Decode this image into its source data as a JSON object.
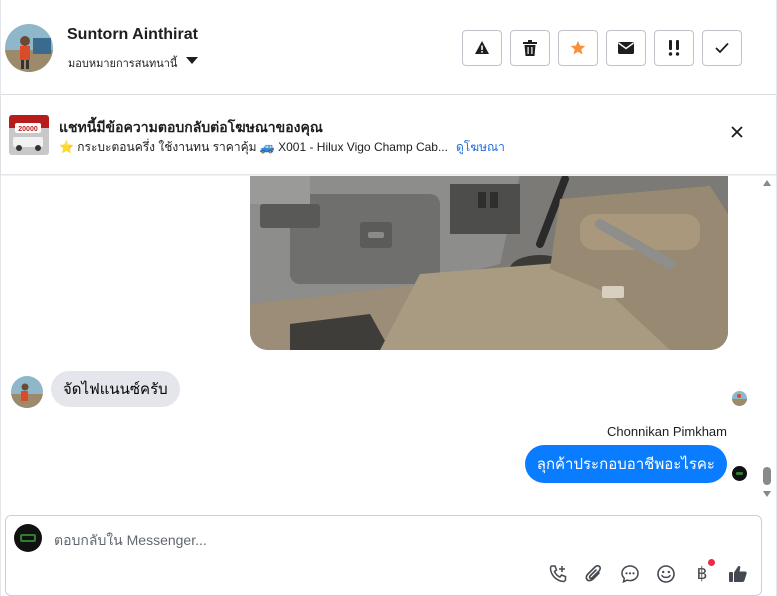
{
  "header": {
    "contact_name": "Suntorn Ainthirat",
    "assign_label": "มอบหมายการสนทนานี้",
    "actions": [
      {
        "icon": "warning-icon"
      },
      {
        "icon": "trash-icon"
      },
      {
        "icon": "star-icon",
        "color": "#f7923b"
      },
      {
        "icon": "envelope-icon"
      },
      {
        "icon": "follow-up-icon"
      },
      {
        "icon": "check-icon"
      }
    ]
  },
  "ad_banner": {
    "title": "แชทนี้มีข้อความตอบกลับต่อโฆษณาของคุณ",
    "subtitle": "⭐ กระบะตอนครึ่ง ใช้งานทน ราคาคุ้ม 🚙 X001 - Hilux Vigo Champ Cab...",
    "link_label": "ดูโฆษณา",
    "thumb_price": "20000"
  },
  "thread": {
    "incoming_message": "จัดไฟแนนซ์ครับ",
    "outgoing_sender": "Chonnikan Pimkham",
    "outgoing_message": "ลุกค้าประกอบอาชีพอะไรคะ"
  },
  "composer": {
    "placeholder": "ตอบกลับใน Messenger...",
    "tools": [
      "call-add-icon",
      "attach-icon",
      "saved-reply-icon",
      "emoji-icon",
      "baht-payment-icon",
      "like-icon"
    ],
    "baht_symbol": "฿"
  },
  "colors": {
    "accent": "#0a7cff",
    "link": "#216fdb",
    "like": "#444950",
    "notification_dot": "#f02849"
  }
}
